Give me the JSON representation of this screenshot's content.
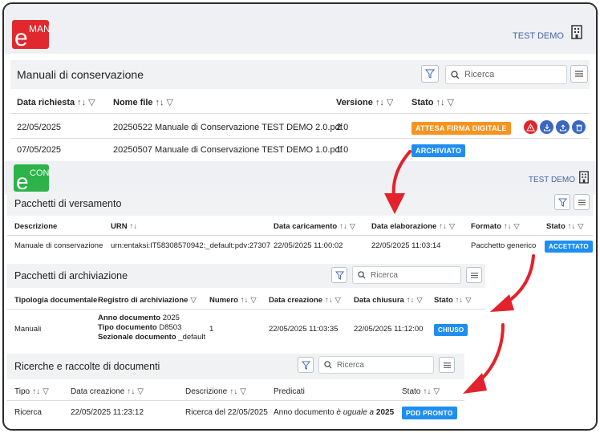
{
  "header": {
    "logo_eman": "MAN",
    "logo_eman_prefix": "e",
    "org": "TEST DEMO"
  },
  "manuali": {
    "title": "Manuali di conservazione",
    "search_placeholder": "Ricerca",
    "columns": [
      "Data richiesta",
      "Nome file",
      "Versione",
      "Stato"
    ],
    "rows": [
      {
        "data": "22/05/2025",
        "file": "20250522 Manuale di Conservazione TEST DEMO 2.0.pdf",
        "versione": "2.0",
        "stato": "ATTESA FIRMA DIGITALE"
      },
      {
        "data": "07/05/2025",
        "file": "20250507 Manuale di Conservazione TEST DEMO 1.0.pdf",
        "versione": "1.0",
        "stato": "ARCHIVIATO"
      }
    ]
  },
  "econ": {
    "logo": "CON",
    "logo_prefix": "e",
    "org": "TEST DEMO"
  },
  "versamento": {
    "title": "Pacchetti di versamento",
    "columns": [
      "Descrizione",
      "URN",
      "Data caricamento",
      "Data elaborazione",
      "Formato",
      "Stato"
    ],
    "row": {
      "descrizione": "Manuale di conservazione",
      "urn": "urn:entaksi:IT58308570942:_default:pdv:27307",
      "caricamento": "22/05/2025 11:00:02",
      "elaborazione": "22/05/2025 11:03:14",
      "formato": "Pacchetto generico",
      "stato": "ACCETTATO"
    }
  },
  "archiviazione": {
    "title": "Pacchetti di archiviazione",
    "search_placeholder": "Ricerca",
    "columns": [
      "Tipologia documentale",
      "Registro di archiviazione",
      "Numero",
      "Data creazione",
      "Data chiusura",
      "Stato"
    ],
    "row": {
      "tipologia": "Manuali",
      "reg1_label": "Anno documento",
      "reg1_value": "2025",
      "reg2_label": "Tipo documento",
      "reg2_value": "D8503",
      "reg3_label": "Sezionale documento",
      "reg3_value": "_default",
      "numero": "1",
      "creazione": "22/05/2025 11:03:35",
      "chiusura": "22/05/2025 11:12:00",
      "stato": "CHIUSO"
    }
  },
  "ricerche": {
    "title": "Ricerche e raccolte di documenti",
    "search_placeholder": "Ricerca",
    "columns": [
      "Tipo",
      "Data creazione",
      "Descrizione",
      "Predicati",
      "Stato"
    ],
    "row": {
      "tipo": "Ricerca",
      "creazione": "22/05/2025 11:23:12",
      "descrizione": "Ricerca del 22/05/2025",
      "pred_a": "Anno documento",
      "pred_b": "è uguale a",
      "pred_c": "2025",
      "stato": "PDD PRONTO"
    }
  },
  "colors": {
    "orange": "#f7931e",
    "blue": "#1f8ef1",
    "red_arrow": "#e3222c",
    "logo_red": "#e0282e",
    "logo_green": "#2db34a"
  }
}
